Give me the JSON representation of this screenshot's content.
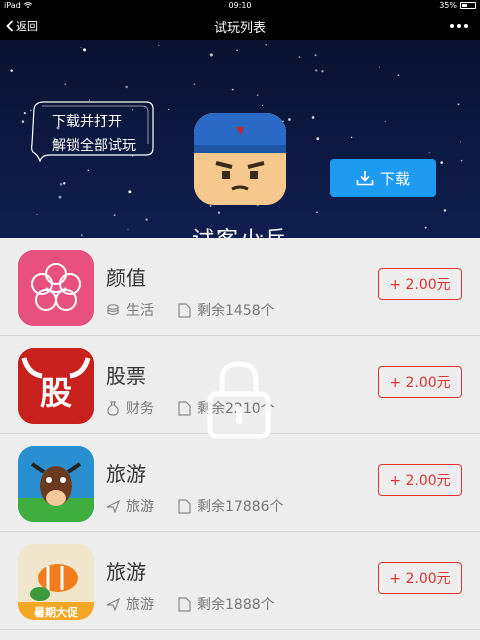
{
  "status_bar": {
    "device": "iPad",
    "time": "09:10",
    "battery": "35%",
    "battery_level": 0.35
  },
  "nav": {
    "back_label": "返回",
    "title": "试玩列表"
  },
  "banner": {
    "bubble_line1": "下载并打开",
    "bubble_line2": "解锁全部试玩",
    "app_name": "试客小兵",
    "download_label": "下载"
  },
  "items": [
    {
      "title": "颜值",
      "category": "生活",
      "remaining": "剩余1458个",
      "reward": "+ 2.00元",
      "icon": "flower-app-icon",
      "category_icon": "coins-icon"
    },
    {
      "title": "股票",
      "category": "财务",
      "remaining": "剩余2210个",
      "reward": "+ 2.00元",
      "icon": "bull-app-icon",
      "category_icon": "money-bag-icon"
    },
    {
      "title": "旅游",
      "category": "旅游",
      "remaining": "剩余17886个",
      "reward": "+ 2.00元",
      "icon": "cow-app-icon",
      "category_icon": "plane-icon"
    },
    {
      "title": "旅游",
      "category": "旅游",
      "remaining": "剩余1888个",
      "reward": "+ 2.00元",
      "icon": "fish-app-icon",
      "category_icon": "plane-icon",
      "icon_text": "暑期大促"
    }
  ],
  "colors": {
    "accent_blue": "#1d9bf0",
    "reward_red": "#dd3333",
    "banner_bg": "#0d1a45"
  }
}
